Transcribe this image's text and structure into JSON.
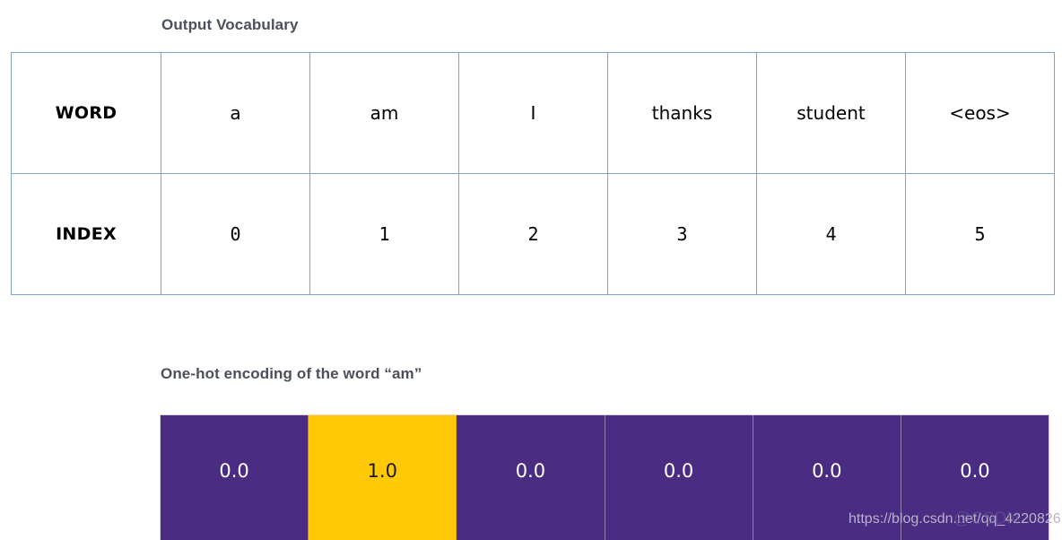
{
  "vocabulary": {
    "title": "Output Vocabulary",
    "row_labels": {
      "word": "WORD",
      "index": "INDEX"
    },
    "words": [
      "a",
      "am",
      "I",
      "thanks",
      "student",
      "<eos>"
    ],
    "indices": [
      "0",
      "1",
      "2",
      "3",
      "4",
      "5"
    ]
  },
  "onehot": {
    "title": "One-hot encoding of the word “am”",
    "values": [
      "0.0",
      "1.0",
      "0.0",
      "0.0",
      "0.0",
      "0.0"
    ],
    "hot_index": 1,
    "colors": {
      "zero": "#4a2d82",
      "one": "#ffc907",
      "border": "#7ea5c9"
    }
  },
  "watermark": {
    "url": "https://blog.csdn.net/qq_4220826",
    "badge": "@CSDN"
  }
}
